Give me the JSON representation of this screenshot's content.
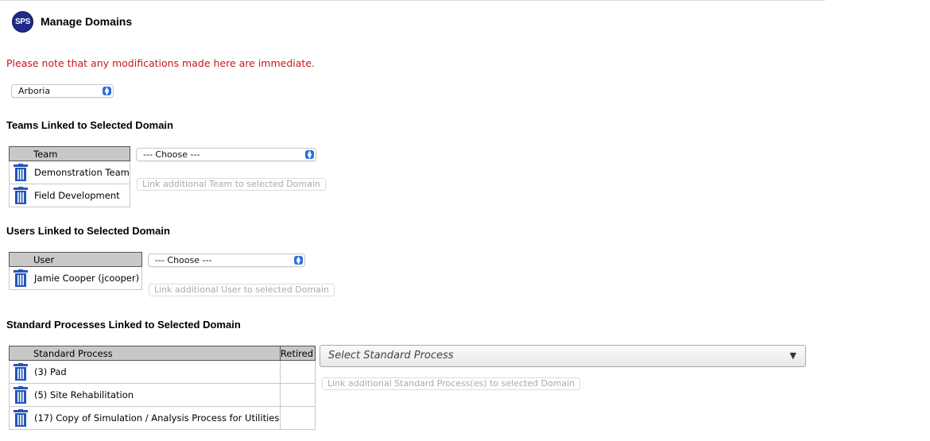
{
  "header": {
    "logo_text": "SPS",
    "title": "Manage Domains"
  },
  "notice": "Please note that any modifications made here are immediate.",
  "domain_select": {
    "value": "Arboria"
  },
  "teams": {
    "title": "Teams Linked to Selected Domain",
    "column": "Team",
    "rows": [
      "Demonstration Team",
      "Field Development"
    ],
    "select_value": "--- Choose ---",
    "link_button": "Link additional Team to selected Domain"
  },
  "users": {
    "title": "Users Linked to Selected Domain",
    "column": "User",
    "rows": [
      "Jamie Cooper (jcooper)"
    ],
    "select_value": "--- Choose ---",
    "link_button": "Link additional User to selected Domain"
  },
  "processes": {
    "title": "Standard Processes Linked to Selected Domain",
    "columns": [
      "Standard Process",
      "Retired"
    ],
    "rows": [
      {
        "name": "(3) Pad",
        "retired": ""
      },
      {
        "name": "(5) Site Rehabilitation",
        "retired": ""
      },
      {
        "name": "(17) Copy of Simulation / Analysis Process for Utilities",
        "retired": ""
      }
    ],
    "select_placeholder": "Select Standard Process",
    "link_button": "Link additional Standard Process(es) to selected Domain"
  },
  "colors": {
    "accent": "#2f6fe0",
    "notice": "#c8141e",
    "logo": "#1c2b8c",
    "trash": "#2556b8"
  },
  "icons": {
    "delete": "trash-icon",
    "stepper": "updown-stepper-icon",
    "dropdown": "caret-down-icon"
  }
}
